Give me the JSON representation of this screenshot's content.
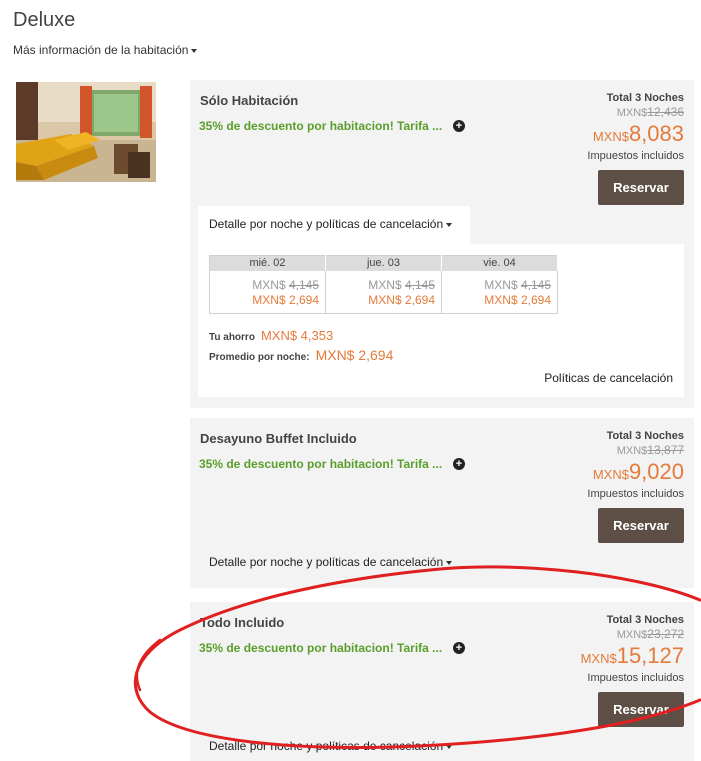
{
  "room": {
    "title": "Deluxe",
    "more_info": "Más información de la habitación"
  },
  "rates": [
    {
      "name": "Sólo Habitación",
      "promo": "35% de descuento por habitacion! Tarifa ...",
      "total_label": "Total 3  Noches",
      "original_currency": "MXN$",
      "original_amount": "12,436",
      "currency": "MXN$",
      "price": "8,083",
      "taxes": "Impuestos incluidos",
      "book": "Reservar",
      "details": "Detalle por noche y políticas de cancelación",
      "nights": [
        {
          "day": "mié. 02",
          "was_currency": "MXN$",
          "was": "4,145",
          "now": "MXN$ 2,694"
        },
        {
          "day": "jue. 03",
          "was_currency": "MXN$",
          "was": "4,145",
          "now": "MXN$ 2,694"
        },
        {
          "day": "vie. 04",
          "was_currency": "MXN$",
          "was": "4,145",
          "now": "MXN$ 2,694"
        }
      ],
      "savings_label": "Tu ahorro",
      "savings_value": "MXN$  4,353",
      "avg_label": "Promedio por noche:",
      "avg_value": "MXN$ 2,694",
      "cancel_policies": "Políticas de cancelación"
    },
    {
      "name": "Desayuno Buffet Incluido",
      "promo": "35% de descuento por habitacion! Tarifa ...",
      "total_label": "Total 3  Noches",
      "original_currency": "MXN$",
      "original_amount": "13,877",
      "currency": "MXN$",
      "price": "9,020",
      "taxes": "Impuestos incluidos",
      "book": "Reservar",
      "details": "Detalle por noche y políticas de cancelación"
    },
    {
      "name": "Todo Incluido",
      "promo": "35% de descuento por habitacion! Tarifa ...",
      "total_label": "Total 3  Noches",
      "original_currency": "MXN$",
      "original_amount": "23,272",
      "currency": "MXN$",
      "price": "15,127",
      "taxes": "Impuestos incluidos",
      "book": "Reservar",
      "details": "Detalle por noche y políticas de cancelación"
    }
  ],
  "icons": {
    "plus": "plus-circle-icon",
    "caret": "caret-down-icon"
  },
  "colors": {
    "promo": "#5a9e2b",
    "price": "#e57a3a",
    "button": "#5d4f45",
    "annotation": "#e02020"
  }
}
